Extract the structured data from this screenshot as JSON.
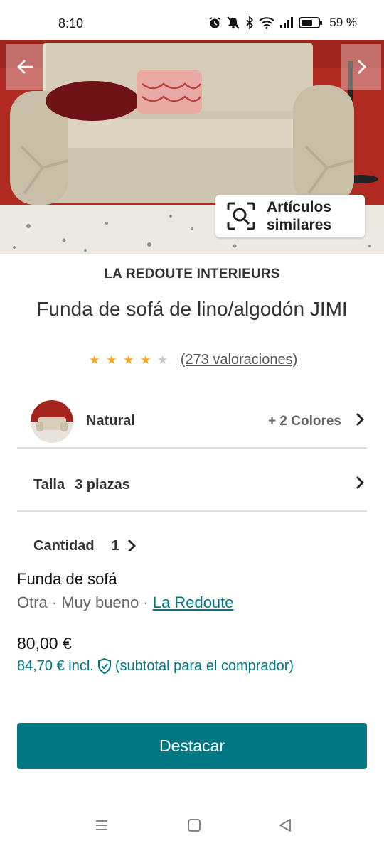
{
  "status_bar": {
    "time": "8:10",
    "battery": "59 %",
    "icons": [
      "alarm-icon",
      "mute-icon",
      "bluetooth-icon",
      "wifi-icon",
      "signal-icon",
      "battery-icon"
    ]
  },
  "gallery": {
    "prev_icon": "arrow-left-icon",
    "next_icon": "chevron-right-icon",
    "similar_line1": "Artículos",
    "similar_line2": "similares"
  },
  "product": {
    "brand": "LA REDOUTE INTERIEURS",
    "title": "Funda de sofá de lino/algodón JIMI",
    "rating_stars": 4,
    "rating_max": 5,
    "reviews": "(273 valoraciones)"
  },
  "options": {
    "color_name": "Natural",
    "more_colors": "+ 2 Colores",
    "size_label": "Talla",
    "size_value": "3 plazas",
    "quantity_label": "Cantidad",
    "quantity_value": "1"
  },
  "listing": {
    "title": "Funda de sofá",
    "meta_prefix": "Otra · Muy bueno · ",
    "seller": "La Redoute",
    "price": "80,00 €",
    "buyer_price": "84,70 € incl.",
    "buyer_note": "(subtotal para el comprador)"
  },
  "actions": {
    "highlight_button": "Destacar"
  },
  "colors": {
    "accent": "#007782",
    "star": "#f5a623"
  }
}
